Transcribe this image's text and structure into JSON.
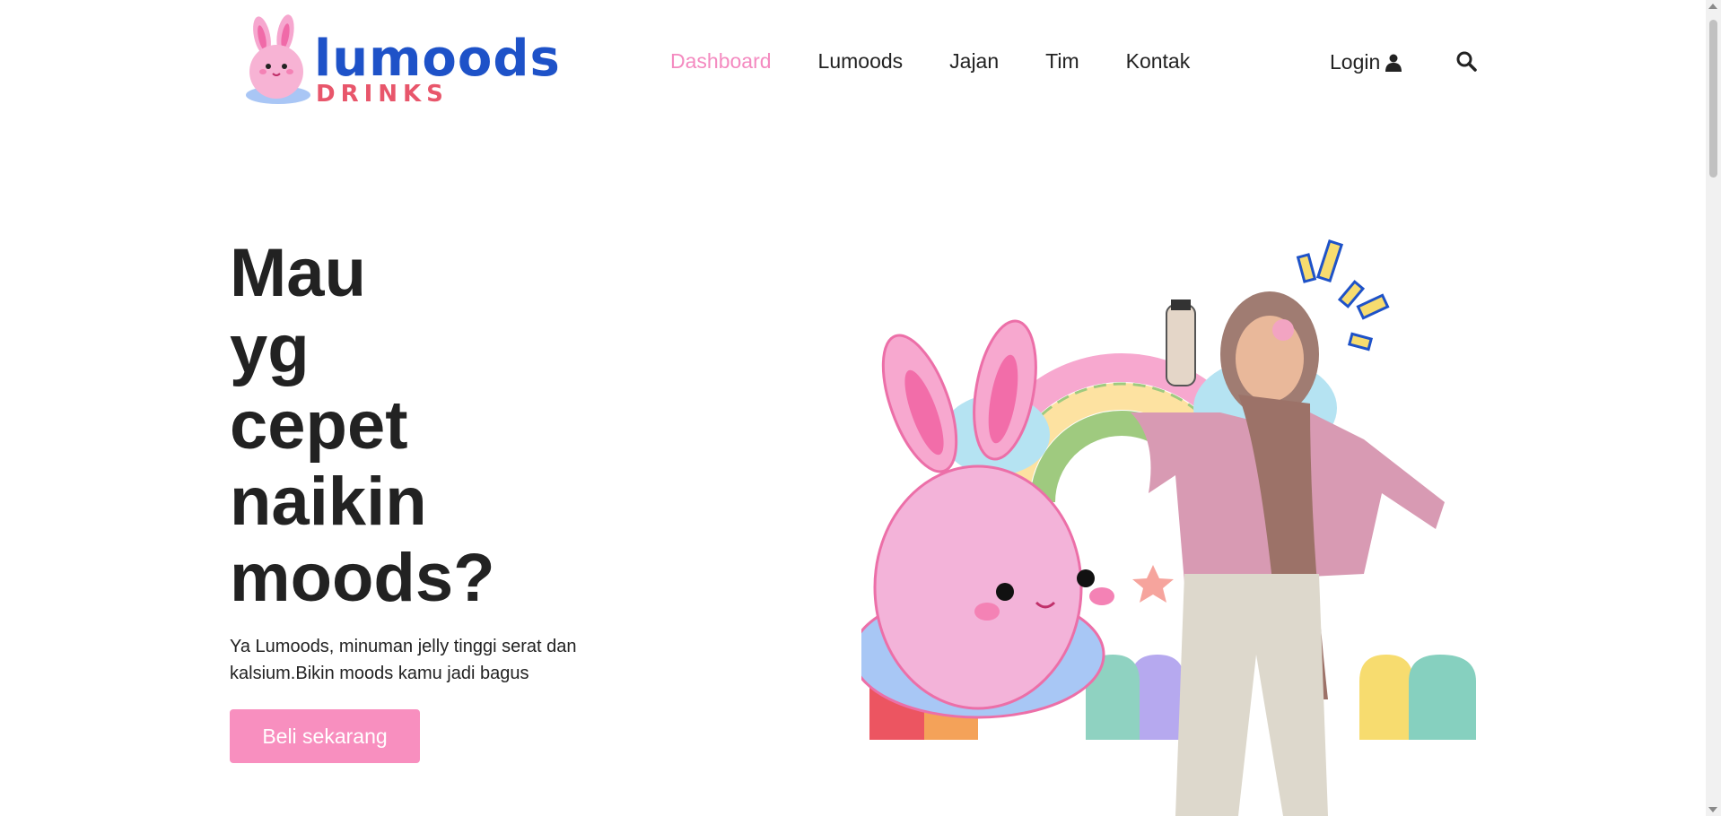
{
  "brand": {
    "name_line1": "lumoods",
    "name_line2": "DRINKS",
    "primary_color": "#1e52c8",
    "secondary_color": "#e8566b",
    "accent_color": "#f88fbf"
  },
  "nav": {
    "items": [
      {
        "label": "Dashboard",
        "active": true
      },
      {
        "label": "Lumoods",
        "active": false
      },
      {
        "label": "Jajan",
        "active": false
      },
      {
        "label": "Tim",
        "active": false
      },
      {
        "label": "Kontak",
        "active": false
      }
    ],
    "login_label": "Login",
    "login_icon": "user-icon",
    "search_icon": "search-icon"
  },
  "hero": {
    "title_lines": [
      "Mau",
      "yg",
      "cepet",
      "naikin",
      "moods?"
    ],
    "subtitle": "Ya Lumoods, minuman jelly tinggi serat dan kalsium.Bikin moods kamu jadi bagus",
    "cta_label": "Beli sekarang"
  }
}
